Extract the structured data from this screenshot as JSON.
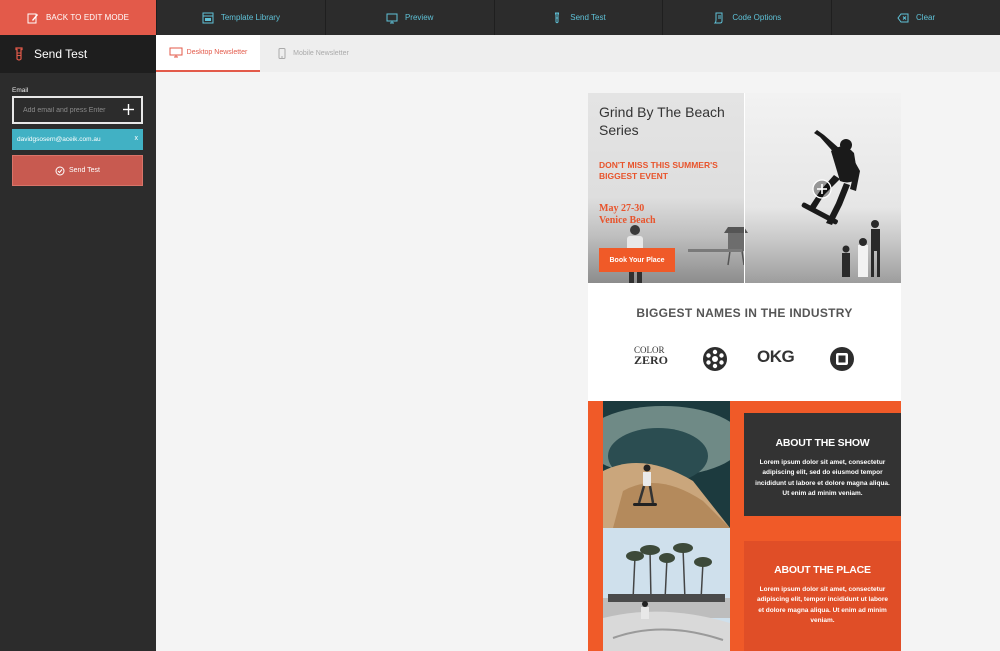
{
  "topbar": {
    "back_label": "BACK TO EDIT MODE",
    "nav": [
      {
        "label": "Template Library",
        "icon": "template-icon"
      },
      {
        "label": "Preview",
        "icon": "monitor-icon"
      },
      {
        "label": "Send Test",
        "icon": "flask-icon"
      },
      {
        "label": "Code Options",
        "icon": "code-icon"
      },
      {
        "label": "Clear",
        "icon": "clear-icon"
      }
    ]
  },
  "sidebar": {
    "title": "Send Test",
    "email_label": "Email",
    "email_placeholder": "Add email and press Enter",
    "chip_email": "davidgsosern@aceik.com.au",
    "chip_remove": "x",
    "send_label": "Send Test"
  },
  "tabs": [
    {
      "label": "Desktop Newsletter",
      "active": true
    },
    {
      "label": "Mobile Newsletter",
      "active": false
    }
  ],
  "newsletter": {
    "hero": {
      "title": "Grind By The Beach Series",
      "subtitle": "DON'T MISS THIS SUMMER'S BIGGEST EVENT",
      "date_line1": "May 27-30",
      "date_line2": "Venice Beach",
      "button": "Book Your Place"
    },
    "names": {
      "title": "BIGGEST NAMES IN THE INDUSTRY",
      "logo1_line1": "COLOR",
      "logo1_line2": "ZERO",
      "logo3": "OKG"
    },
    "show": {
      "title": "ABOUT THE SHOW",
      "text": "Lorem ipsum dolor sit amet, consectetur adipiscing elit, sed do eiusmod tempor incididunt ut labore et dolore magna aliqua. Ut enim ad minim veniam."
    },
    "place": {
      "title": "ABOUT THE PLACE",
      "text": "Lorem ipsum dolor sit amet, consectetur adipiscing elit, tempor incididunt ut labore et dolore magna aliqua. Ut enim ad minim veniam."
    }
  },
  "colors": {
    "accent": "#e35a4a",
    "teal": "#41b1c4",
    "orange": "#f05a28",
    "dark": "#2c2c2c"
  }
}
